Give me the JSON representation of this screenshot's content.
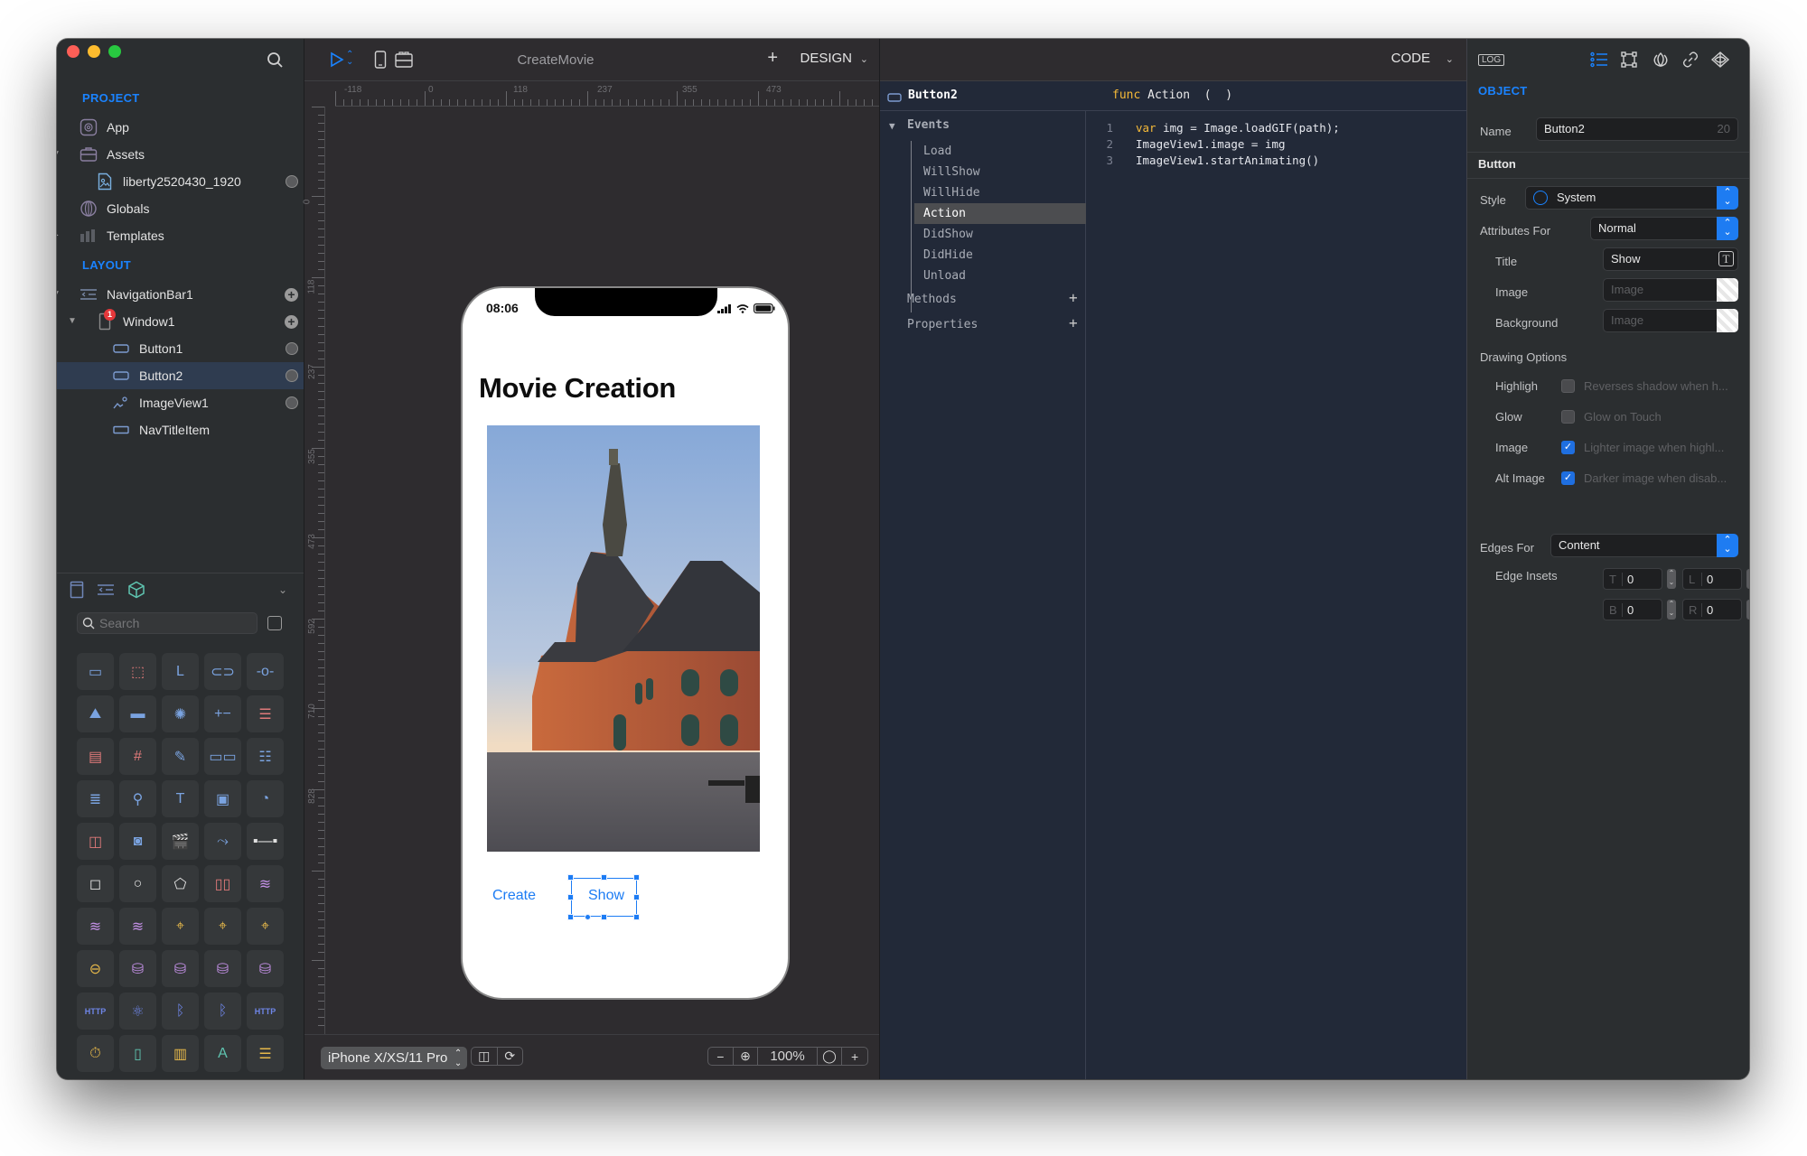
{
  "sidebar": {
    "project_title": "PROJECT",
    "layout_title": "LAYOUT",
    "project_items": [
      {
        "label": "App",
        "icon": "app-icon"
      },
      {
        "label": "Assets",
        "icon": "briefcase-icon",
        "expanded": true
      },
      {
        "label": "liberty2520430_1920",
        "icon": "image-file-icon"
      },
      {
        "label": "Globals",
        "icon": "globe-icon"
      },
      {
        "label": "Templates",
        "icon": "templates-icon",
        "expanded": false
      }
    ],
    "layout_items": [
      {
        "label": "NavigationBar1",
        "icon": "navigation-bar-icon",
        "expanded": true
      },
      {
        "label": "Window1",
        "icon": "window-icon",
        "expanded": true,
        "badge": "1"
      },
      {
        "label": "Button1",
        "icon": "button-icon"
      },
      {
        "label": "Button2",
        "icon": "button-icon",
        "selected": true
      },
      {
        "label": "ImageView1",
        "icon": "image-view-icon"
      },
      {
        "label": "NavTitleItem",
        "icon": "nav-title-item-icon"
      }
    ],
    "library": {
      "search_placeholder": "Search",
      "tabs": [
        "window-tab-icon",
        "navigation-tab-icon",
        "objects-tab-icon"
      ],
      "items": [
        {
          "icon": "button-icon",
          "glyph": "▭",
          "color": "#7aa3e0"
        },
        {
          "icon": "view-icon",
          "glyph": "⬚",
          "color": "#e07a7a"
        },
        {
          "icon": "label-icon",
          "glyph": "L",
          "color": "#7aa3e0"
        },
        {
          "icon": "switch-icon",
          "glyph": "⊂⊃",
          "color": "#7aa3e0"
        },
        {
          "icon": "slider-icon",
          "glyph": "-o-",
          "color": "#7aa3e0"
        },
        {
          "icon": "image-view-icon",
          "glyph": "⛰",
          "color": "#7aa3e0"
        },
        {
          "icon": "progress-icon",
          "glyph": "▬",
          "color": "#7aa3e0"
        },
        {
          "icon": "spinner-icon",
          "glyph": "✺",
          "color": "#7aa3e0"
        },
        {
          "icon": "stepper-icon",
          "glyph": "+−",
          "color": "#7aa3e0"
        },
        {
          "icon": "picker-icon",
          "glyph": "☰",
          "color": "#e07a7a"
        },
        {
          "icon": "table-icon",
          "glyph": "▤",
          "color": "#e07a7a"
        },
        {
          "icon": "grid-icon",
          "glyph": "#",
          "color": "#e07a7a"
        },
        {
          "icon": "compass-icon",
          "glyph": "✎",
          "color": "#7aa3e0"
        },
        {
          "icon": "segmented-icon",
          "glyph": "▭▭",
          "color": "#7aa3e0"
        },
        {
          "icon": "textfield-icon",
          "glyph": "☷",
          "color": "#7aa3e0"
        },
        {
          "icon": "textview-icon",
          "glyph": "≣",
          "color": "#7aa3e0"
        },
        {
          "icon": "search-bar-icon",
          "glyph": "⚲",
          "color": "#7aa3e0"
        },
        {
          "icon": "text-icon",
          "glyph": "T",
          "color": "#7aa3e0"
        },
        {
          "icon": "webview-icon",
          "glyph": "▣",
          "color": "#7aa3e0"
        },
        {
          "icon": "chart-icon",
          "glyph": "◔",
          "color": "#7aa3e0"
        },
        {
          "icon": "carousel-icon",
          "glyph": "◫",
          "color": "#e07a7a"
        },
        {
          "icon": "camera-icon",
          "glyph": "◙",
          "color": "#7aa3e0"
        },
        {
          "icon": "video-icon",
          "glyph": "🎬",
          "color": "#7aa3e0"
        },
        {
          "icon": "path-icon",
          "glyph": "⤳",
          "color": "#7aa3e0"
        },
        {
          "icon": "line-icon",
          "glyph": "▪—▪",
          "color": "#e0e0e0"
        },
        {
          "icon": "rect-shape-icon",
          "glyph": "◻",
          "color": "#e0e0e0"
        },
        {
          "icon": "circle-shape-icon",
          "glyph": "○",
          "color": "#e0e0e0"
        },
        {
          "icon": "polygon-shape-icon",
          "glyph": "⬠",
          "color": "#e0e0e0"
        },
        {
          "icon": "columns-icon",
          "glyph": "▯▯",
          "color": "#e07a7a"
        },
        {
          "icon": "layers-icon",
          "glyph": "≋",
          "color": "#c792ea"
        },
        {
          "icon": "layers-icon",
          "glyph": "≋",
          "color": "#c792ea"
        },
        {
          "icon": "layers-icon",
          "glyph": "≋",
          "color": "#c792ea"
        },
        {
          "icon": "location-pin-icon",
          "glyph": "⌖",
          "color": "#e6b84a"
        },
        {
          "icon": "location-pin-icon",
          "glyph": "⌖",
          "color": "#e6b84a"
        },
        {
          "icon": "location-pin-icon",
          "glyph": "⌖",
          "color": "#e6b84a"
        },
        {
          "icon": "gyroscope-icon",
          "glyph": "⊖",
          "color": "#e6b84a"
        },
        {
          "icon": "database-icon",
          "glyph": "⛁",
          "color": "#c792ea"
        },
        {
          "icon": "database-icon",
          "glyph": "⛁",
          "color": "#c792ea"
        },
        {
          "icon": "database-icon",
          "glyph": "⛁",
          "color": "#c792ea"
        },
        {
          "icon": "database-icon",
          "glyph": "⛁",
          "color": "#c792ea"
        },
        {
          "icon": "http-download-icon",
          "glyph": "HTTP",
          "color": "#6f86e8"
        },
        {
          "icon": "network-icon",
          "glyph": "⚛",
          "color": "#6f86e8"
        },
        {
          "icon": "bluetooth-icon",
          "glyph": "ᛒ",
          "color": "#6f86e8"
        },
        {
          "icon": "bluetooth-icon",
          "glyph": "ᛒ",
          "color": "#6f86e8"
        },
        {
          "icon": "http-upload-icon",
          "glyph": "HTTP",
          "color": "#6f86e8"
        },
        {
          "icon": "timer-icon",
          "glyph": "⏱",
          "color": "#e6b84a"
        },
        {
          "icon": "microphone-icon",
          "glyph": "▯",
          "color": "#5fc4b0"
        },
        {
          "icon": "file-icon",
          "glyph": "▥",
          "color": "#e6b84a"
        },
        {
          "icon": "appstore-icon",
          "glyph": "A",
          "color": "#5fc4b0"
        },
        {
          "icon": "drawer-icon",
          "glyph": "☰",
          "color": "#e6b84a"
        }
      ]
    }
  },
  "design": {
    "document_title": "CreateMovie",
    "mode_label": "DESIGN",
    "ruler_top": [
      "-118",
      "0",
      "118",
      "237",
      "355",
      "473"
    ],
    "ruler_left": [
      "0",
      "118",
      "237",
      "355",
      "473",
      "592",
      "710",
      "828"
    ],
    "phone": {
      "time": "08:06",
      "nav_title": "Movie Creation",
      "buttons": [
        "Create",
        "Show"
      ]
    },
    "device": "iPhone X/XS/11 Pro",
    "zoom": "100%"
  },
  "code": {
    "mode_label": "CODE",
    "object_name": "Button2",
    "func_keyword": "func",
    "func_signature": "Action  (  )",
    "events_label": "Events",
    "events": [
      "Load",
      "WillShow",
      "WillHide",
      "Action",
      "DidShow",
      "DidHide",
      "Unload"
    ],
    "selected_event": "Action",
    "methods_label": "Methods",
    "properties_label": "Properties",
    "lines": [
      {
        "n": "1",
        "kw": "var",
        "rest": " img = Image.loadGIF(path);"
      },
      {
        "n": "2",
        "kw": "",
        "rest": "ImageView1.image = img"
      },
      {
        "n": "3",
        "kw": "",
        "rest": "ImageView1.startAnimating()"
      }
    ]
  },
  "inspector": {
    "log_label": "LOG",
    "section_title": "OBJECT",
    "name_label": "Name",
    "name_value": "Button2",
    "name_max": "20",
    "group_title": "Button",
    "style_label": "Style",
    "style_value": "System",
    "attributes_for_label": "Attributes For",
    "attributes_for_value": "Normal",
    "title_label": "Title",
    "title_value": "Show",
    "image_label": "Image",
    "image_placeholder": "Image",
    "background_label": "Background",
    "background_placeholder": "Image",
    "drawing_options_label": "Drawing Options",
    "options": [
      {
        "label": "Highligh",
        "checked": false,
        "desc": "Reverses shadow when h..."
      },
      {
        "label": "Glow",
        "checked": false,
        "desc": "Glow on Touch"
      },
      {
        "label": "Image",
        "checked": true,
        "desc": "Lighter image when highl..."
      },
      {
        "label": "Alt Image",
        "checked": true,
        "desc": "Darker image when disab..."
      }
    ],
    "edges_for_label": "Edges For",
    "edges_for_value": "Content",
    "edge_insets_label": "Edge Insets",
    "insets": [
      {
        "key": "T",
        "value": "0"
      },
      {
        "key": "L",
        "value": "0"
      },
      {
        "key": "B",
        "value": "0"
      },
      {
        "key": "R",
        "value": "0"
      }
    ]
  },
  "colors": {
    "accent": "#1a83ff",
    "badge": "#e5383b",
    "code_keyword": "#f6ba38"
  }
}
